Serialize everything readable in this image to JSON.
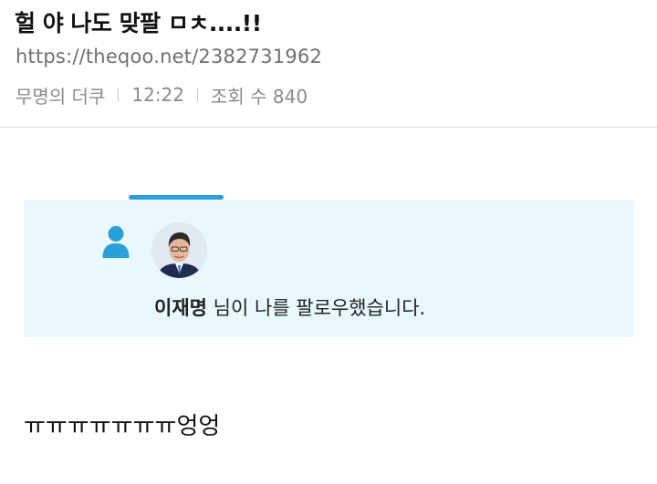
{
  "post": {
    "title": "헐 야 나도 맞팔 ㅁㅊ....!!",
    "url": "https://theqoo.net/2382731962",
    "author": "무명의 더쿠",
    "time": "12:22",
    "views": "조회 수 840"
  },
  "notification": {
    "user": "이재명",
    "message": " 님이 나를 팔로우했습니다."
  },
  "body": {
    "text": "ㅠㅠㅠㅠㅠㅠㅠ엉엉"
  },
  "colors": {
    "accent_blue": "#2b9fd8",
    "card_background": "#e8f8fd"
  },
  "icons": {
    "follow": "person-icon",
    "profile": "avatar"
  }
}
